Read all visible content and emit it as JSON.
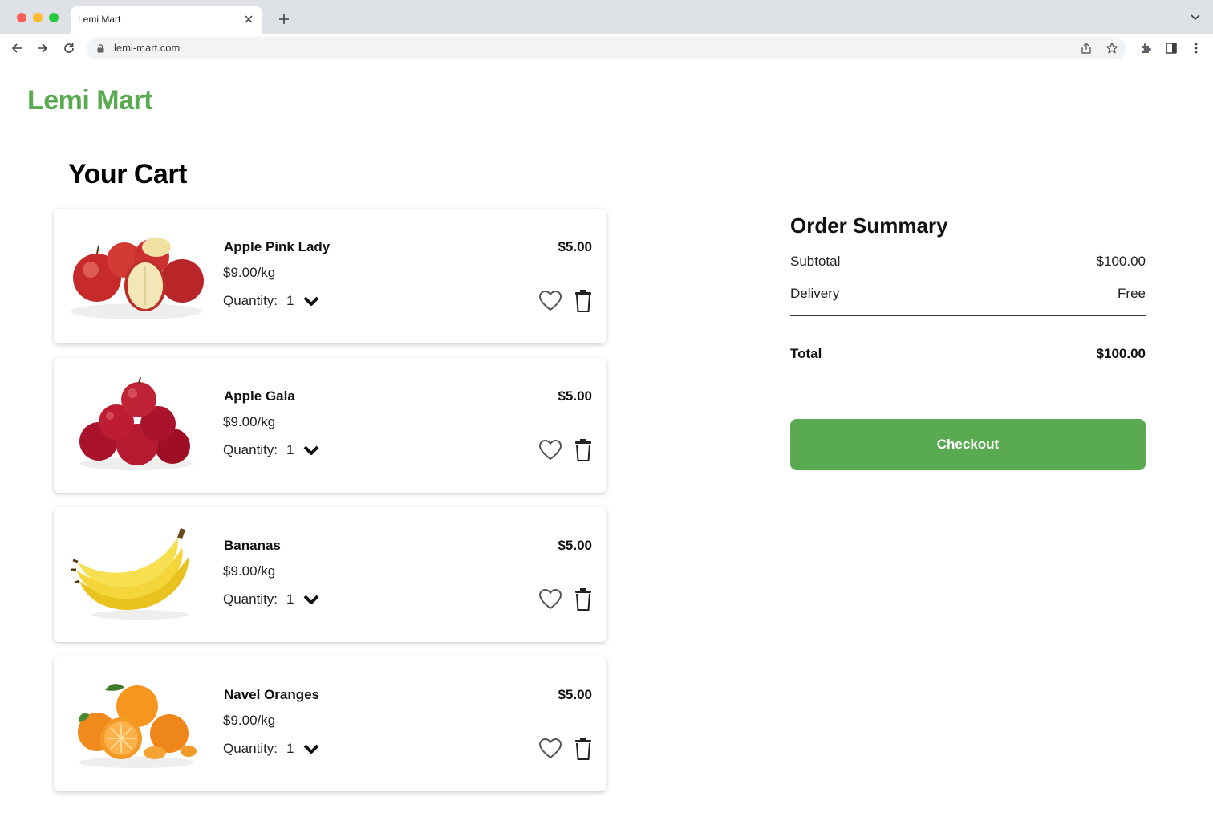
{
  "browser": {
    "tab_title": "Lemi Mart",
    "url": "lemi-mart.com"
  },
  "site": {
    "logo": "Lemi Mart"
  },
  "cart": {
    "title": "Your Cart",
    "quantity_label": "Quantity:",
    "items": [
      {
        "name": "Apple Pink Lady",
        "unit_price": "$9.00/kg",
        "quantity": "1",
        "price": "$5.00",
        "image": "red-apples-image"
      },
      {
        "name": "Apple Gala",
        "unit_price": "$9.00/kg",
        "quantity": "1",
        "price": "$5.00",
        "image": "gala-apples-image"
      },
      {
        "name": "Bananas",
        "unit_price": "$9.00/kg",
        "quantity": "1",
        "price": "$5.00",
        "image": "bananas-image"
      },
      {
        "name": "Navel Oranges",
        "unit_price": "$9.00/kg",
        "quantity": "1",
        "price": "$5.00",
        "image": "oranges-image"
      }
    ]
  },
  "summary": {
    "title": "Order Summary",
    "subtotal_label": "Subtotal",
    "subtotal_value": "$100.00",
    "delivery_label": "Delivery",
    "delivery_value": "Free",
    "total_label": "Total",
    "total_value": "$100.00",
    "checkout_label": "Checkout"
  },
  "colors": {
    "brand": "#5aaa52",
    "tabbar": "#dee1e6"
  }
}
